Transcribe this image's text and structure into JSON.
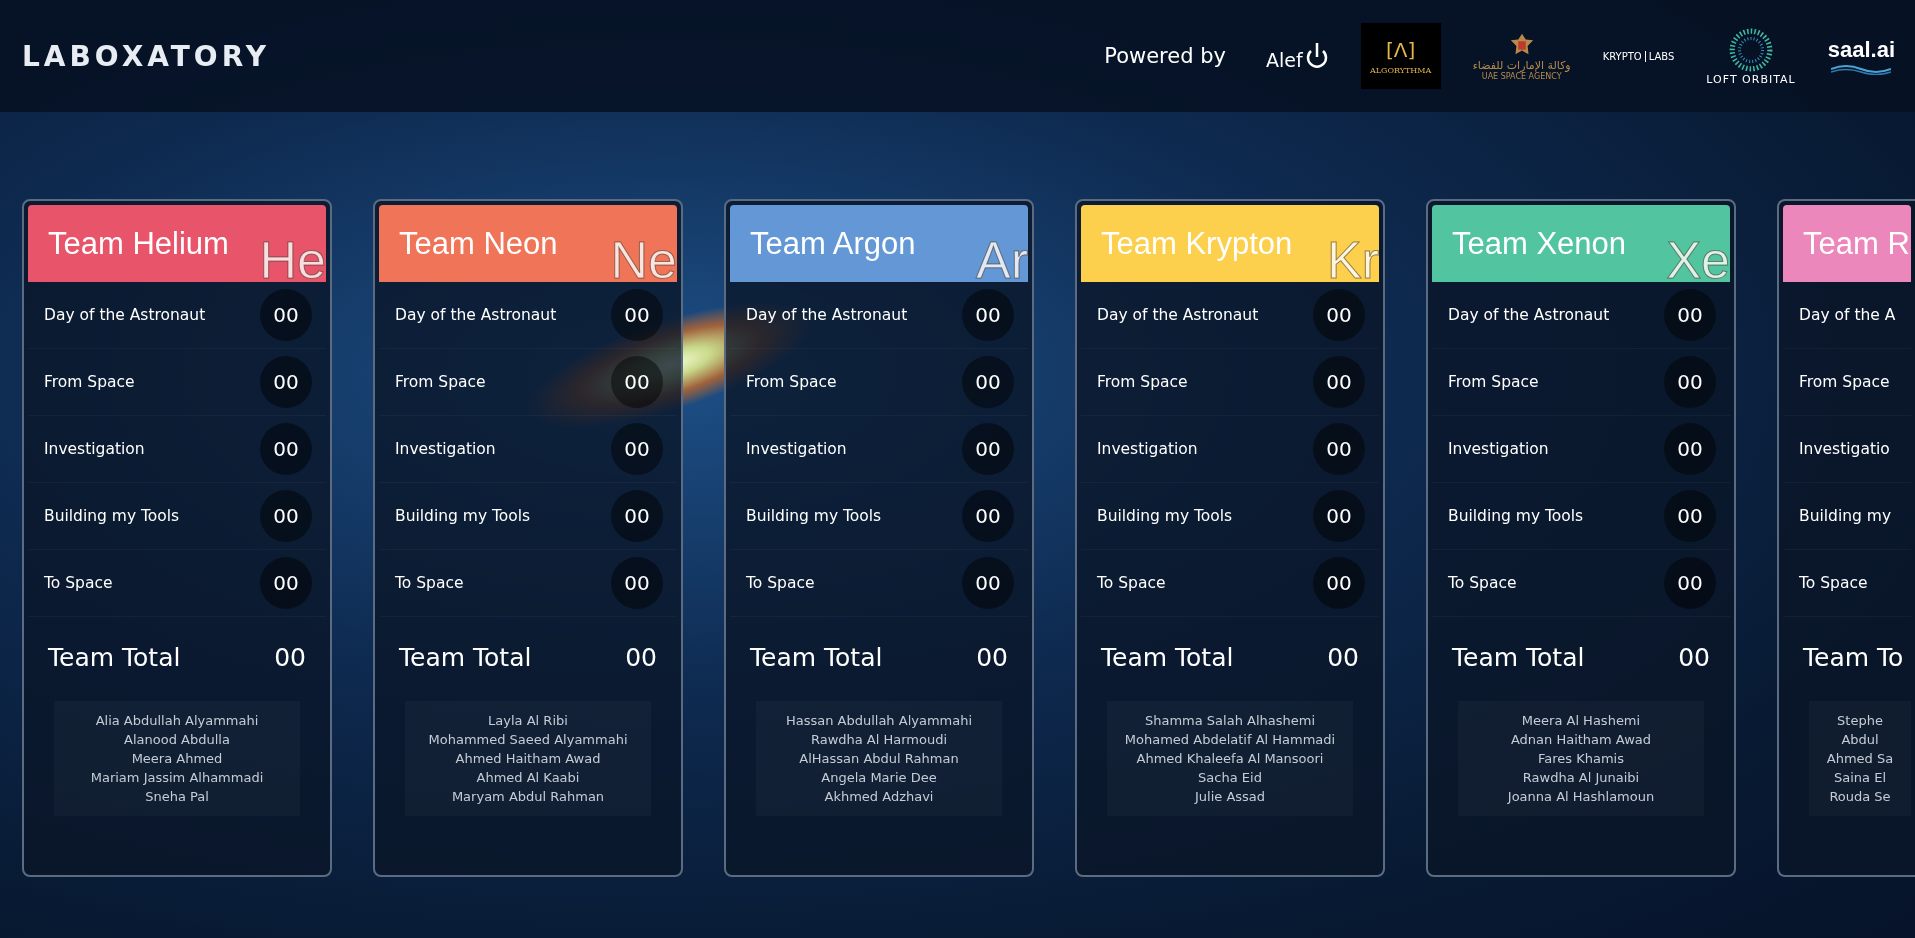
{
  "header": {
    "logo": "LABOXATORY",
    "powered_by": "Powered by",
    "partners": [
      {
        "kind": "alef",
        "name": "Alef"
      },
      {
        "kind": "algorythma",
        "mark": "[Λ]",
        "name": "ALGORYTHMA"
      },
      {
        "kind": "agency",
        "arabic": "وكالة الإمارات للفضاء",
        "name": "UAE SPACE AGENCY"
      },
      {
        "kind": "krypto",
        "left": "KRYPTO",
        "right": "LABS"
      },
      {
        "kind": "loft",
        "name": "LOFT ORBITAL"
      },
      {
        "kind": "saal",
        "name": "saal.ai"
      }
    ]
  },
  "teams": [
    {
      "name": "Team Helium",
      "symbol": "He",
      "color": "#e8546a",
      "categories": [
        {
          "label": "Day of the Astronaut",
          "value": "00"
        },
        {
          "label": "From Space",
          "value": "00"
        },
        {
          "label": "Investigation",
          "value": "00"
        },
        {
          "label": "Building my Tools",
          "value": "00"
        },
        {
          "label": "To Space",
          "value": "00"
        }
      ],
      "total_label": "Team Total",
      "total": "00",
      "members": [
        "Alia Abdullah Alyammahi",
        "Alanood Abdulla",
        "Meera Ahmed",
        "Mariam Jassim Alhammadi",
        "Sneha Pal"
      ]
    },
    {
      "name": "Team Neon",
      "symbol": "Ne",
      "color": "#f07458",
      "categories": [
        {
          "label": "Day of the Astronaut",
          "value": "00"
        },
        {
          "label": "From Space",
          "value": "00"
        },
        {
          "label": "Investigation",
          "value": "00"
        },
        {
          "label": "Building my Tools",
          "value": "00"
        },
        {
          "label": "To Space",
          "value": "00"
        }
      ],
      "total_label": "Team Total",
      "total": "00",
      "members": [
        "Layla Al Ribi",
        "Mohammed Saeed Alyammahi",
        "Ahmed Haitham Awad",
        "Ahmed Al Kaabi",
        "Maryam Abdul Rahman"
      ]
    },
    {
      "name": "Team Argon",
      "symbol": "Ar",
      "color": "#6397d6",
      "categories": [
        {
          "label": "Day of the Astronaut",
          "value": "00"
        },
        {
          "label": "From Space",
          "value": "00"
        },
        {
          "label": "Investigation",
          "value": "00"
        },
        {
          "label": "Building my Tools",
          "value": "00"
        },
        {
          "label": "To Space",
          "value": "00"
        }
      ],
      "total_label": "Team Total",
      "total": "00",
      "members": [
        "Hassan Abdullah Alyammahi",
        "Rawdha Al Harmoudi",
        "AlHassan Abdul Rahman",
        "Angela Marie Dee",
        "Akhmed Adzhavi"
      ]
    },
    {
      "name": "Team Krypton",
      "symbol": "Kr",
      "color": "#fccf4c",
      "categories": [
        {
          "label": "Day of the Astronaut",
          "value": "00"
        },
        {
          "label": "From Space",
          "value": "00"
        },
        {
          "label": "Investigation",
          "value": "00"
        },
        {
          "label": "Building my Tools",
          "value": "00"
        },
        {
          "label": "To Space",
          "value": "00"
        }
      ],
      "total_label": "Team Total",
      "total": "00",
      "members": [
        "Shamma Salah Alhashemi",
        "Mohamed Abdelatif Al Hammadi",
        "Ahmed Khaleefa Al Mansoori",
        "Sacha Eid",
        "Julie Assad"
      ]
    },
    {
      "name": "Team Xenon",
      "symbol": "Xe",
      "color": "#52c4a0",
      "categories": [
        {
          "label": "Day of the Astronaut",
          "value": "00"
        },
        {
          "label": "From Space",
          "value": "00"
        },
        {
          "label": "Investigation",
          "value": "00"
        },
        {
          "label": "Building my Tools",
          "value": "00"
        },
        {
          "label": "To Space",
          "value": "00"
        }
      ],
      "total_label": "Team Total",
      "total": "00",
      "members": [
        "Meera Al Hashemi",
        "Adnan Haitham Awad",
        "Fares Khamis",
        "Rawdha Al Junaibi",
        "Joanna Al Hashlamoun"
      ]
    },
    {
      "name": "Team R",
      "color": "#ec87bb",
      "categories": [
        {
          "label": "Day of the A"
        },
        {
          "label": "From Space"
        },
        {
          "label": "Investigatio"
        },
        {
          "label": "Building my"
        },
        {
          "label": "To Space"
        }
      ],
      "total_label": "Team To",
      "members": [
        "Stephe",
        "Abdul",
        "Ahmed Sa",
        "Saina El",
        "Rouda Se"
      ]
    }
  ]
}
